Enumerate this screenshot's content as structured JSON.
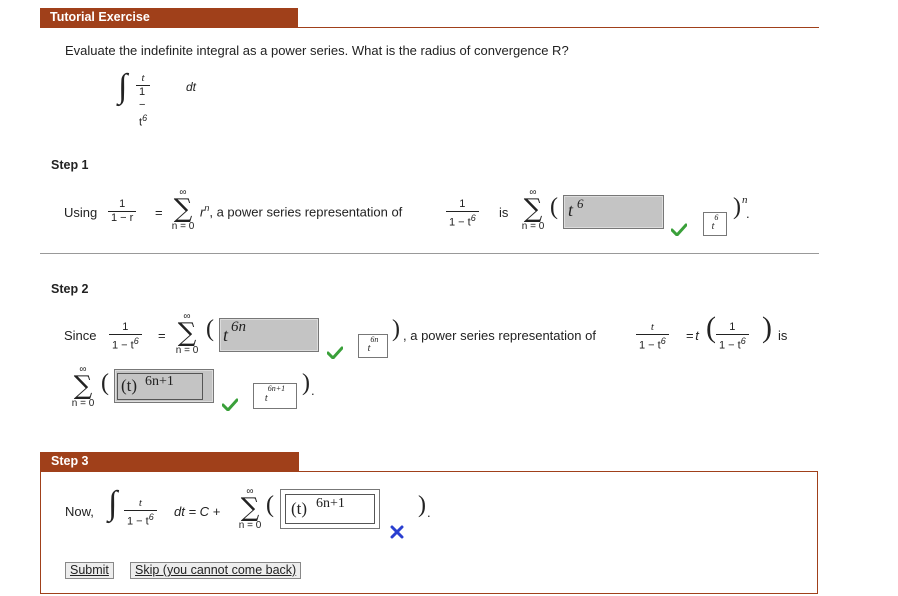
{
  "header": {
    "title": "Tutorial Exercise"
  },
  "question": {
    "text": "Evaluate the indefinite integral as a power series. What is the radius of convergence R?"
  },
  "integral": {
    "num": "t",
    "den": "1 − t6",
    "d": "dt"
  },
  "step1": {
    "label": "Step 1",
    "using": "Using",
    "frac_num": "1",
    "frac_den": "1 − r",
    "eq": "=",
    "term": "r",
    "term_exp": "n",
    "text": ", a power series representation of",
    "frac2_num": "1",
    "frac2_den": "1 − t",
    "frac2_den_exp": "6",
    "is": "is",
    "answer": "t",
    "answer_exp": "6",
    "preview": "t",
    "preview_exp": "6",
    "outer_exp": "n",
    "sigma_top": "∞",
    "sigma_bottom": "n = 0"
  },
  "step2": {
    "label": "Step 2",
    "since": "Since",
    "frac_num": "1",
    "frac_den": "1 − t",
    "frac_den_exp": "6",
    "eq": "=",
    "answer": "t",
    "answer_exp": "6n",
    "preview": "t",
    "preview_exp": "6n",
    "text": ", a power series representation of",
    "frac2_num": "t",
    "frac2_den": "1 − t",
    "frac2_den_exp": "6",
    "eq2": "= t",
    "frac3_num": "1",
    "frac3_den": "1 − t",
    "frac3_den_exp": "6",
    "is": "is",
    "answer2_base": "(t)",
    "answer2_exp": "6n+1",
    "preview2": "t",
    "preview2_exp": "6n+1",
    "period": ".",
    "sigma_top": "∞",
    "sigma_bottom": "n = 0"
  },
  "step3": {
    "label": "Step 3",
    "now": "Now,",
    "frac_num": "t",
    "frac_den": "1 − t",
    "frac_den_exp": "6",
    "tail": "dt = C +",
    "answer_base": "(t)",
    "answer_exp": "6n+1",
    "period": ".",
    "sigma_top": "∞",
    "sigma_bottom": "n = 0"
  },
  "buttons": {
    "submit": "Submit",
    "skip": "Skip (you cannot come back)"
  },
  "colors": {
    "banner": "#a0401a",
    "check": "#3aa03a",
    "cross": "#2a3fd0",
    "answer_bg": "#c4c4c4"
  }
}
